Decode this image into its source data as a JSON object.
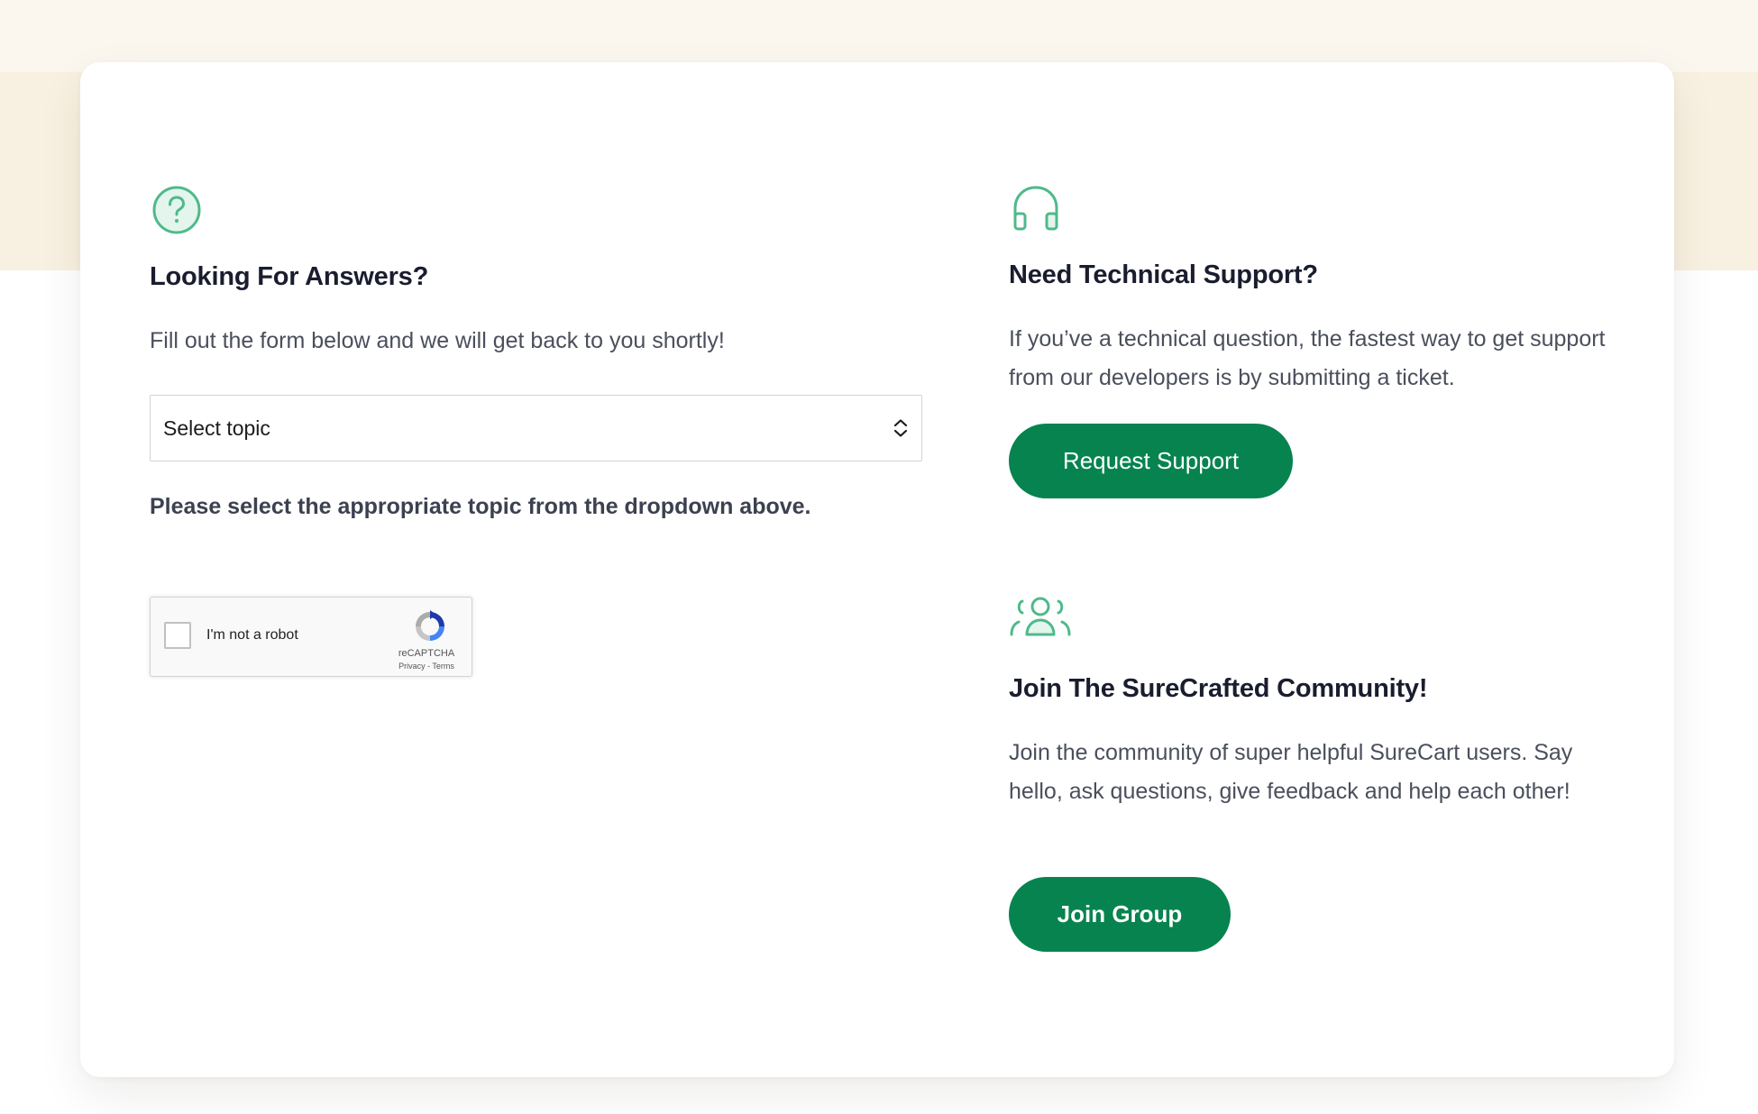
{
  "colors": {
    "accent": "#07834f",
    "icon_green": "#4fb98a",
    "icon_fill": "#e3f5ec",
    "band": "#f8f0e0"
  },
  "left": {
    "icon": "question-circle-icon",
    "title": "Looking For Answers?",
    "description": "Fill out the form below and we will get back to you shortly!",
    "select": {
      "selected": "Select topic",
      "icon": "chevron-up-down-icon"
    },
    "hint": "Please select the appropriate topic from the dropdown above.",
    "captcha": {
      "label": "I'm not a robot",
      "brand": "reCAPTCHA",
      "links": "Privacy - Terms",
      "icon": "recaptcha-logo-icon"
    }
  },
  "support": {
    "icon": "headphones-icon",
    "title": "Need Technical Support?",
    "description": "If you’ve a technical question, the fastest way to get support from our developers is by submitting a ticket.",
    "button_label": "Request Support"
  },
  "community": {
    "icon": "users-group-icon",
    "title": "Join The SureCrafted Community!",
    "description": "Join the community of super helpful SureCart users. Say hello, ask questions, give feedback and help each other!",
    "button_label": "Join Group"
  }
}
